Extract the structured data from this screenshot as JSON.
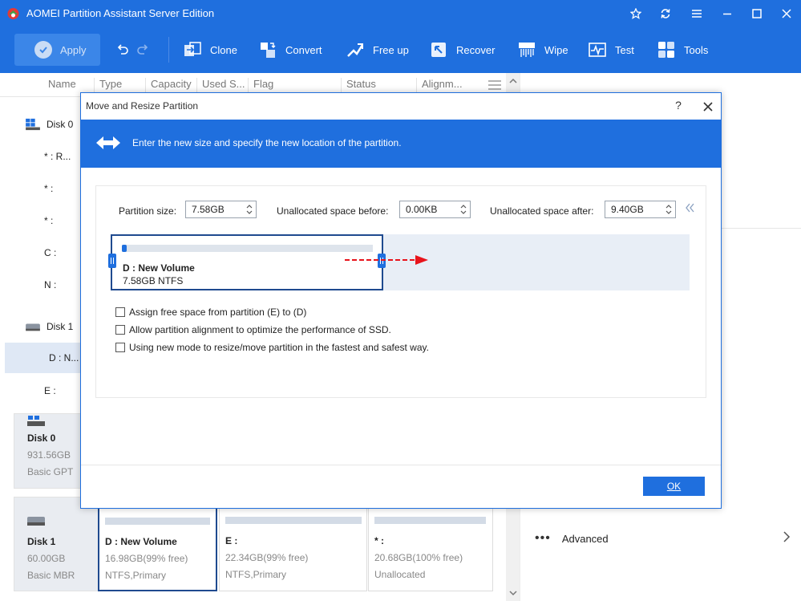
{
  "app": {
    "title": "AOMEI Partition Assistant Server Edition"
  },
  "toolbar": {
    "apply_label": "Apply",
    "tools": [
      {
        "label": "Clone",
        "icon": "clone-icon"
      },
      {
        "label": "Convert",
        "icon": "convert-icon"
      },
      {
        "label": "Free up",
        "icon": "free-up-icon"
      },
      {
        "label": "Recover",
        "icon": "recover-icon"
      },
      {
        "label": "Wipe",
        "icon": "wipe-icon"
      },
      {
        "label": "Test",
        "icon": "test-icon"
      },
      {
        "label": "Tools",
        "icon": "tools-icon"
      }
    ]
  },
  "columns": [
    "Name",
    "Type",
    "Capacity",
    "Used S...",
    "Flag",
    "Status",
    "Alignm..."
  ],
  "tree": {
    "disk0": "Disk 0",
    "disk0_parts": [
      "* : R...",
      "* :",
      "* :",
      "C :",
      "N :"
    ],
    "disk1": "Disk 1",
    "disk1_parts": [
      "D : N...",
      "E :"
    ]
  },
  "disk_map": {
    "disk0": {
      "name": "Disk 0",
      "size": "931.56GB",
      "style": "Basic GPT"
    },
    "disk1": {
      "name": "Disk 1",
      "size": "60.00GB",
      "style": "Basic MBR"
    },
    "partitions": [
      {
        "name": "D : New Volume",
        "size": "16.98GB(99% free)",
        "fs": "NTFS,Primary",
        "selected": true
      },
      {
        "name": "E :",
        "size": "22.34GB(99% free)",
        "fs": "NTFS,Primary",
        "selected": false
      },
      {
        "name": "* :",
        "size": "20.68GB(100% free)",
        "fs": "Unallocated",
        "selected": false
      }
    ]
  },
  "right_panel": {
    "advanced_label": "Advanced"
  },
  "dialog": {
    "title": "Move and Resize Partition",
    "help": "?",
    "banner_text": "Enter the new size and specify the new location of the partition.",
    "partition_size_label": "Partition size:",
    "partition_size_value": "7.58GB",
    "unalloc_before_label": "Unallocated space before:",
    "unalloc_before_value": "0.00KB",
    "unalloc_after_label": "Unallocated space after:",
    "unalloc_after_value": "9.40GB",
    "partition_name": "D : New Volume",
    "partition_detail": "7.58GB NTFS",
    "used_fraction": 0.02,
    "options": [
      {
        "label": "Assign free space from partition (E) to (D)",
        "checked": false
      },
      {
        "label": "Allow partition alignment to optimize the performance of SSD.",
        "checked": false
      },
      {
        "label": "Using new mode to resize/move partition in the fastest and safest way.",
        "checked": false
      }
    ],
    "ok_label": "OK"
  },
  "colors": {
    "accent": "#1f6fde",
    "selected_border": "#1f4a8f",
    "drag_arrow": "#e8131b"
  }
}
